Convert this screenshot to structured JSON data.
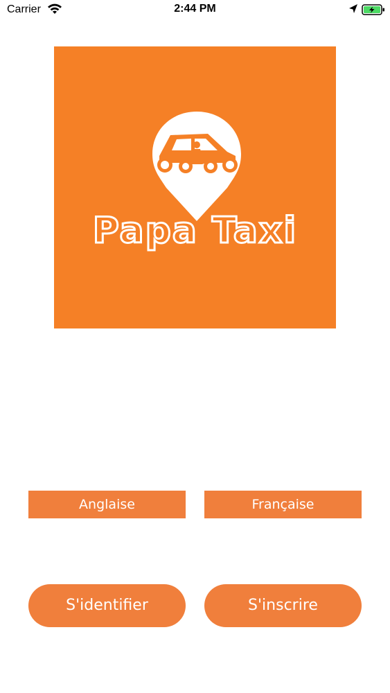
{
  "status_bar": {
    "carrier": "Carrier",
    "time": "2:44 PM",
    "icons": [
      "wifi-icon",
      "location-arrow-icon",
      "battery-charging-icon"
    ]
  },
  "logo": {
    "brand_name": "Papa Taxi",
    "icon": "map-pin-car-motorbike-icon",
    "background_color": "#f58026"
  },
  "language": {
    "english_label": "Anglaise",
    "french_label": "Française"
  },
  "actions": {
    "login_label": "S'identifier",
    "register_label": "S'inscrire"
  },
  "colors": {
    "button_accent": "#f07f3c",
    "battery_fill": "#4cd964"
  }
}
